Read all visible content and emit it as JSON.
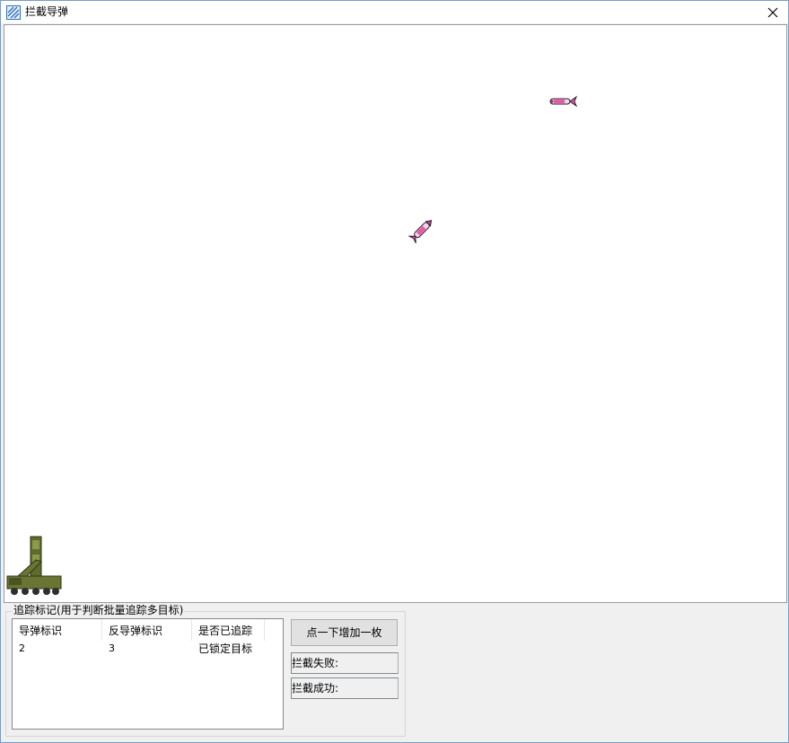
{
  "window": {
    "title": "拦截导弹"
  },
  "canvas": {
    "sprites": [
      "missile",
      "anti-missile",
      "launcher-vehicle"
    ]
  },
  "tracking": {
    "caption": "追踪标记(用于判断批量追踪多目标)",
    "columns": [
      "导弹标识",
      "反导弹标识",
      "是否已追踪"
    ],
    "rows": [
      {
        "missile_id": "2",
        "anti_missile_id": "3",
        "status": "已锁定目标"
      }
    ]
  },
  "controls": {
    "add_button": "点一下增加一枚",
    "fail_label": "拦截失败:",
    "success_label": "拦截成功:"
  },
  "colors": {
    "missile_body": "#e85aa8",
    "launcher_green": "#5e6b2d"
  }
}
